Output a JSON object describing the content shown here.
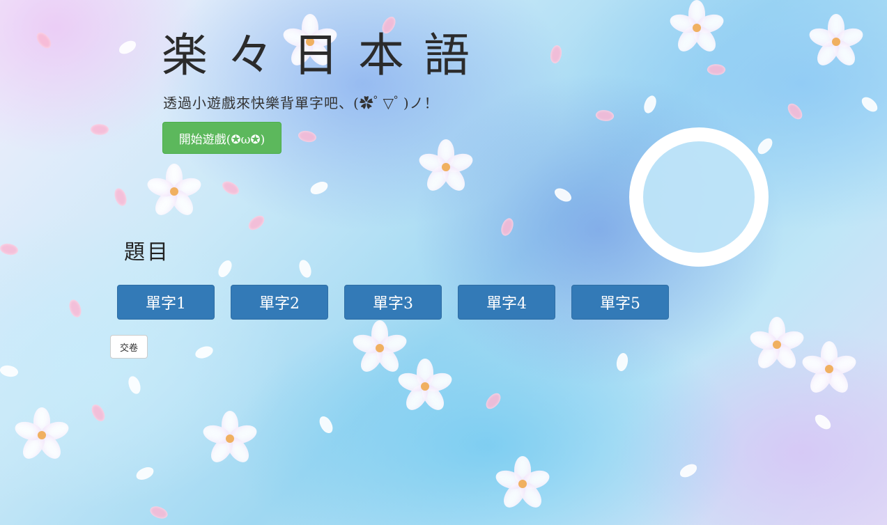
{
  "header": {
    "title": "楽々日本語",
    "subtitle": "透過小遊戲來快樂背單字吧、(✿ ゚ ▽ ゚ )ノ！",
    "start_button_label": "開始遊戲(✪ω✪)"
  },
  "quiz": {
    "question_label": "題目",
    "word_buttons": [
      {
        "label": "單字1"
      },
      {
        "label": "單字2"
      },
      {
        "label": "單字3"
      },
      {
        "label": "單字4"
      },
      {
        "label": "單字5"
      }
    ],
    "submit_label": "交卷"
  },
  "colors": {
    "start_button": "#5cb85c",
    "word_button": "#337ab7",
    "timer_ring": "#ffffff",
    "timer_fill": "#c2e5f8"
  },
  "background": {
    "description_icon": "cherry-blossom-background"
  }
}
